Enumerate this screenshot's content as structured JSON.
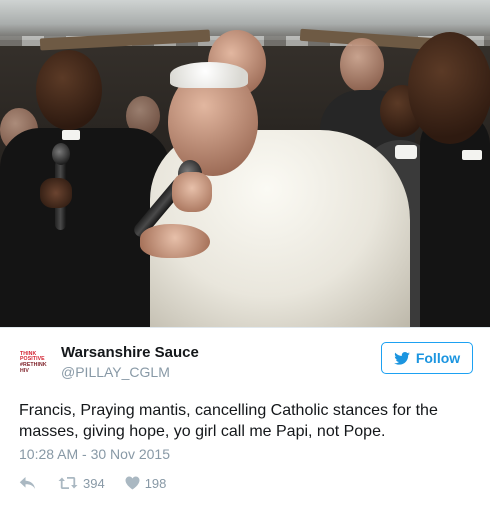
{
  "tweet": {
    "display_name": "Warsanshire Sauce",
    "handle": "@PILLAY_CGLM",
    "avatar_lines": [
      "THINK",
      "POSITIVE",
      "#RETHINK",
      "HIV"
    ],
    "follow_label": "Follow",
    "text": "Francis, Praying mantis, cancelling Catholic stances for the masses, giving hope, yo girl call me Papi, not Pope.",
    "timestamp": "10:28 AM - 30 Nov 2015",
    "retweet_count": "394",
    "like_count": "198"
  },
  "icons": {
    "follow": "twitter-bird-icon",
    "reply": "reply-arrow-icon",
    "retweet": "retweet-icon",
    "like": "heart-icon"
  },
  "colors": {
    "accent": "#1da1f2",
    "text": "#14171a",
    "muted": "#8899a6"
  }
}
